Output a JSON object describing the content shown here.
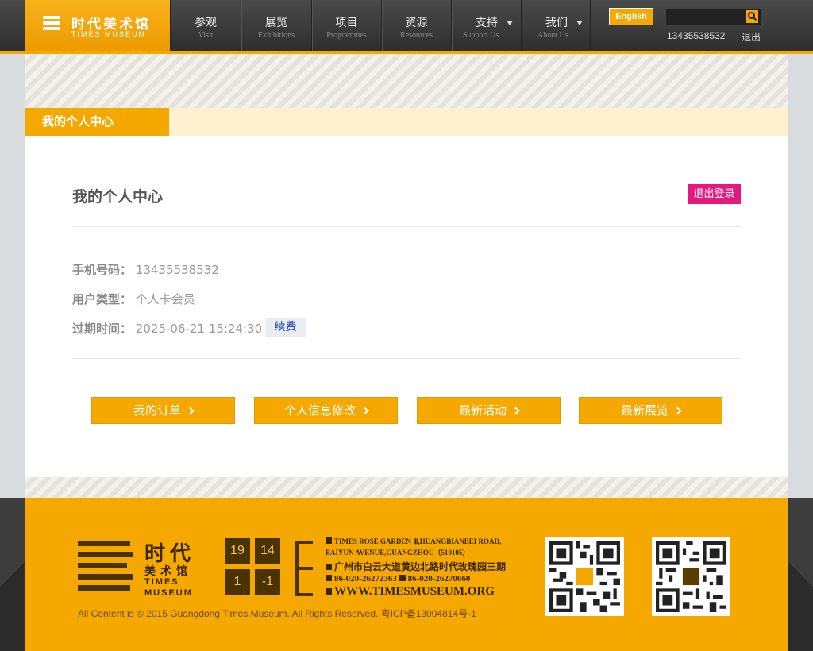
{
  "header": {
    "logo_cn": "时代美术馆",
    "logo_en": "TIMES MUSEUM",
    "nav": [
      {
        "cn": "参观",
        "en": "Visit"
      },
      {
        "cn": "展览",
        "en": "Exhibitions"
      },
      {
        "cn": "项目",
        "en": "Programmes"
      },
      {
        "cn": "资源",
        "en": "Resources"
      },
      {
        "cn": "支持",
        "en": "Support Us"
      },
      {
        "cn": "我们",
        "en": "About Us"
      }
    ],
    "english_label": "English",
    "search_placeholder": "",
    "user_phone": "13435538532",
    "logout_label": "退出"
  },
  "page": {
    "tab_label": "我的个人中心",
    "title": "我的个人中心",
    "logout_button": "退出登录",
    "fields": [
      {
        "label": "手机号码：",
        "value": "13435538532"
      },
      {
        "label": "用户类型：",
        "value": "个人卡会员"
      },
      {
        "label": "过期时间：",
        "value": "2025-06-21 15:24:30"
      }
    ],
    "renew_label": "续费",
    "actions": [
      "我的订单",
      "个人信息修改",
      "最新活动",
      "最新展览"
    ]
  },
  "footer": {
    "logo_cn1": "时代",
    "logo_cn2": "美术馆",
    "logo_en1": "TIMES",
    "logo_en2": "MUSEUM",
    "boxes": [
      "19",
      "14",
      "1",
      "-1"
    ],
    "address_en1": "TIMES ROSE GARDEN Ⅲ,HUANGBIANBEI ROAD,",
    "address_en2": "BAIYUN AVENUE,GUANGZHOU（510105）",
    "address_cn": "广州市白云大道黄边北路时代玫瑰园三期",
    "tel": "86-020-26272363",
    "fax": "86-020-26270660",
    "website": "WWW.TIMESMUSEUM.ORG",
    "copyright": "All Content is © 2015 Guangdong Times Museum. All Rights Reserved. 粤ICP备13004814号-1"
  },
  "colors": {
    "accent": "#f5a800",
    "dark": "#333333",
    "logout": "#e4197f",
    "link": "#1a3fa8"
  }
}
